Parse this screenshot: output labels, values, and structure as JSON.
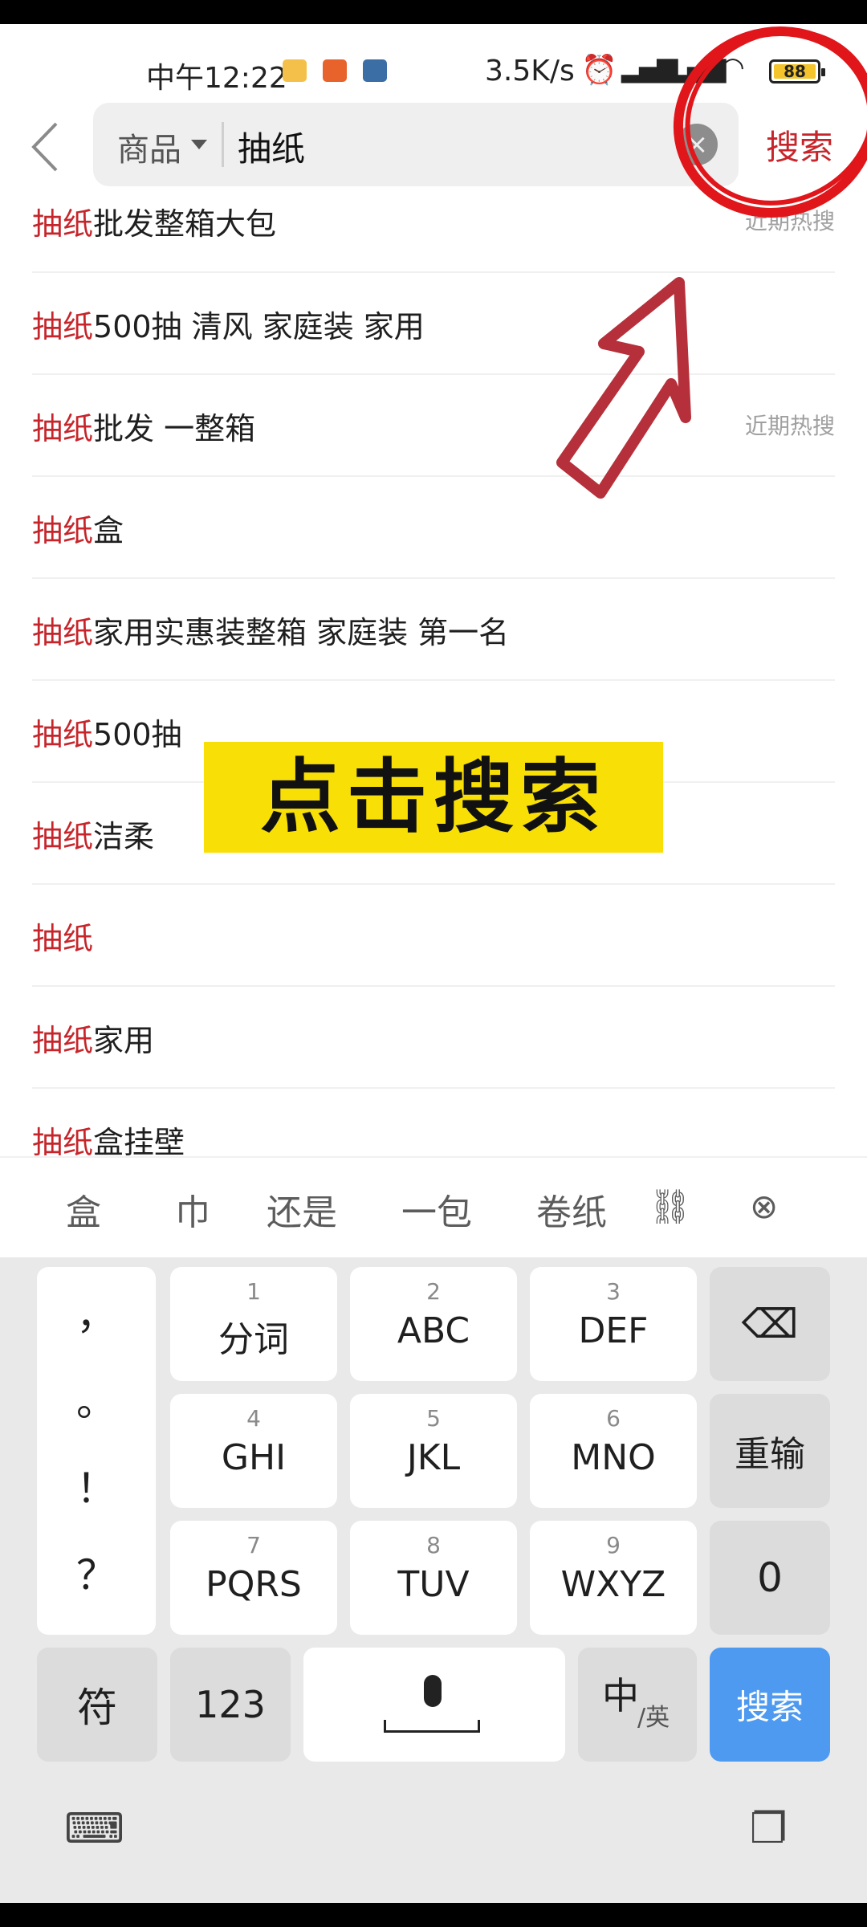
{
  "status_bar": {
    "time": "中午12:22",
    "net_speed": "3.5K/s",
    "alarm_icon": "alarm-icon",
    "signal_1": "HD 4G",
    "signal_2": "HD 4G",
    "battery": "88"
  },
  "header": {
    "back_icon": "chevron-left-icon",
    "scope_label": "商品",
    "search_value": "抽纸",
    "clear_icon": "clear-icon",
    "search_button": "搜索"
  },
  "suggestions": [
    {
      "highlight": "抽纸",
      "rest": "批发整箱大包",
      "tag": "近期热搜"
    },
    {
      "highlight": "抽纸",
      "rest": "500抽 清风 家庭装 家用",
      "tag": ""
    },
    {
      "highlight": "抽纸",
      "rest": "批发 一整箱",
      "tag": "近期热搜"
    },
    {
      "highlight": "抽纸",
      "rest": "盒",
      "tag": ""
    },
    {
      "highlight": "抽纸",
      "rest": "家用实惠装整箱 家庭装 第一名",
      "tag": ""
    },
    {
      "highlight": "抽纸",
      "rest": "500抽",
      "tag": ""
    },
    {
      "highlight": "抽纸",
      "rest": "洁柔",
      "tag": ""
    },
    {
      "highlight": "抽纸",
      "rest": "",
      "tag": ""
    },
    {
      "highlight": "抽纸",
      "rest": "家用",
      "tag": ""
    },
    {
      "highlight": "抽纸",
      "rest": "盒挂壁",
      "tag": ""
    }
  ],
  "overlay": {
    "label": "点击搜索",
    "highlight_color": "#f8e007",
    "annotation_color": "#e0161b"
  },
  "candidates": {
    "words": [
      "盒",
      "巾",
      "还是",
      "一包",
      "卷纸"
    ],
    "link_icon": "link-icon",
    "close_icon": "close-circle-icon"
  },
  "keyboard": {
    "punctuation": [
      "，",
      "。",
      "！",
      "？"
    ],
    "keys": [
      {
        "num": "1",
        "label": "分词"
      },
      {
        "num": "2",
        "label": "ABC"
      },
      {
        "num": "3",
        "label": "DEF"
      },
      {
        "num": "4",
        "label": "GHI"
      },
      {
        "num": "5",
        "label": "JKL"
      },
      {
        "num": "6",
        "label": "MNO"
      },
      {
        "num": "7",
        "label": "PQRS"
      },
      {
        "num": "8",
        "label": "TUV"
      },
      {
        "num": "9",
        "label": "WXYZ"
      }
    ],
    "delete_icon": "backspace-icon",
    "reinput": "重输",
    "zero": "0",
    "symbols": "符",
    "numbers": "123",
    "mic_icon": "microphone-icon",
    "lang_main": "中",
    "lang_sub": "/英",
    "search": "搜索",
    "accent": "#4d9af0"
  },
  "toolbar": {
    "keyboard_icon": "keyboard-icon",
    "clipboard_icon": "clipboard-icon"
  }
}
